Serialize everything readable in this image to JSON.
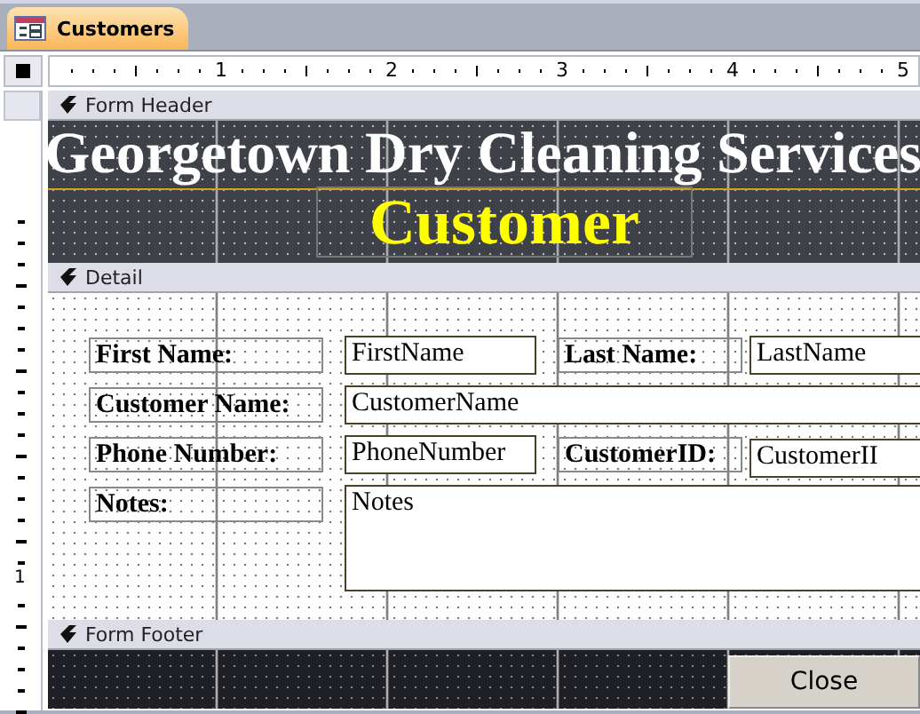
{
  "tab": {
    "label": "Customers",
    "selected": true
  },
  "ruler": {
    "labels": [
      "1",
      "2",
      "3",
      "4",
      "5"
    ],
    "side_labels": [
      "1"
    ]
  },
  "form_header": {
    "bar_label": "Form Header",
    "title": "Georgetown Dry Cleaning Services",
    "subtitle": "Customer"
  },
  "detail": {
    "bar_label": "Detail",
    "fields": [
      {
        "label": "First Name:",
        "value": "FirstName"
      },
      {
        "label": "Last Name:",
        "value": "LastName"
      },
      {
        "label": "Customer Name:",
        "value": "CustomerName"
      },
      {
        "label": "Phone Number:",
        "value": "PhoneNumber"
      },
      {
        "label": "CustomerID:",
        "value": "CustomerII"
      },
      {
        "label": "Notes:",
        "value": "Notes"
      }
    ]
  },
  "form_footer": {
    "bar_label": "Form Footer",
    "button": "Close"
  }
}
